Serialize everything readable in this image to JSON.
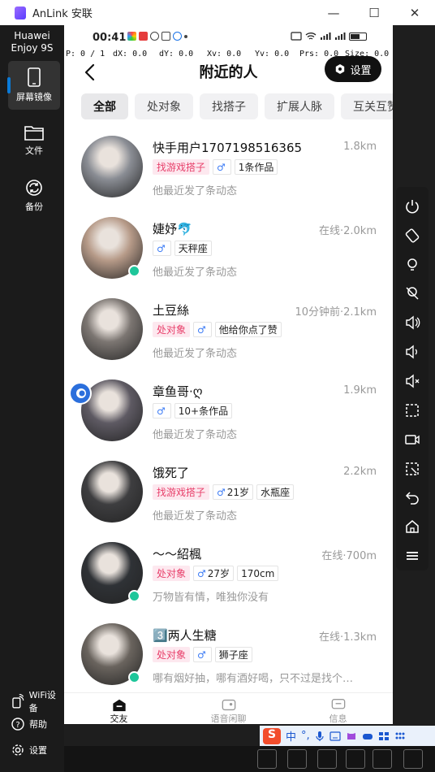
{
  "window": {
    "app_title": "AnLink 安联",
    "minimize": "—",
    "maximize": "☐",
    "close": "✕"
  },
  "sidebar": {
    "device_name_line1": "Huawei",
    "device_name_line2": "Enjoy 9S",
    "items": [
      {
        "label": "屏幕镜像",
        "icon": "phone-icon",
        "active": true
      },
      {
        "label": "文件",
        "icon": "folder-icon"
      },
      {
        "label": "备份",
        "icon": "sync-icon"
      }
    ],
    "bottom": [
      {
        "label": "WiFi设备",
        "icon": "wifi-phone-icon"
      },
      {
        "label": "帮助",
        "icon": "help-icon"
      },
      {
        "label": "设置",
        "icon": "gear-icon"
      }
    ]
  },
  "phone": {
    "status": {
      "time": "00:41",
      "battery_level": 0.6
    },
    "debug": {
      "p": "P: 0 / 1",
      "dx": "dX: 0.0",
      "dy": "dY: 0.0",
      "xv": "Xv: 0.0",
      "yv": "Yv: 0.0",
      "prs": "Prs: 0.0",
      "size": "Size: 0.0"
    },
    "header": {
      "title": "附近的人",
      "settings_label": "设置"
    },
    "tabs": [
      "全部",
      "处对象",
      "找搭子",
      "扩展人脉",
      "互关互赞"
    ],
    "people": [
      {
        "name": "快手用户1707198516365",
        "distance": "1.8km",
        "online": false,
        "tags": [
          {
            "text": "找游戏搭子",
            "style": "pink"
          },
          {
            "text": "",
            "style": "male"
          },
          {
            "text": "1条作品",
            "style": "plain"
          }
        ],
        "sub": "他最近发了条动态",
        "avatar_color": "#8a8d94"
      },
      {
        "name": "婕妤🐬",
        "distance": "在线·2.0km",
        "online": true,
        "tags": [
          {
            "text": "",
            "style": "male"
          },
          {
            "text": "天秤座",
            "style": "plain"
          }
        ],
        "sub": "他最近发了条动态",
        "avatar_color": "#b69a88"
      },
      {
        "name": "土豆絲",
        "distance": "10分钟前·2.1km",
        "online": false,
        "tags": [
          {
            "text": "处对象",
            "style": "pink"
          },
          {
            "text": "",
            "style": "male"
          },
          {
            "text": "他给你点了赞",
            "style": "plain"
          }
        ],
        "sub": "他最近发了条动态",
        "avatar_color": "#7c7672"
      },
      {
        "name": "章鱼哥·ღ",
        "distance": "1.9km",
        "online": false,
        "tags": [
          {
            "text": "",
            "style": "male"
          },
          {
            "text": "10+条作品",
            "style": "plain"
          }
        ],
        "sub": "他最近发了条动态",
        "avatar_color": "#5e5a63"
      },
      {
        "name": "饿死了",
        "distance": "2.2km",
        "online": false,
        "tags": [
          {
            "text": "找游戏搭子",
            "style": "pink"
          },
          {
            "text": "21岁",
            "style": "male"
          },
          {
            "text": "水瓶座",
            "style": "plain"
          }
        ],
        "sub": "他最近发了条动态",
        "avatar_color": "#3e3e40"
      },
      {
        "name": "～～紹楓",
        "distance": "在线·700m",
        "online": true,
        "tags": [
          {
            "text": "处对象",
            "style": "pink"
          },
          {
            "text": "27岁",
            "style": "male"
          },
          {
            "text": "170cm",
            "style": "plain"
          }
        ],
        "sub": "万物皆有情，唯独你没有",
        "avatar_color": "#2f3236"
      },
      {
        "name": "3️⃣两人生糖",
        "distance": "在线·1.3km",
        "online": true,
        "tags": [
          {
            "text": "处对象",
            "style": "pink"
          },
          {
            "text": "",
            "style": "male"
          },
          {
            "text": "狮子座",
            "style": "plain"
          }
        ],
        "sub": "哪有烟好抽，哪有酒好喝，只不过是找个…",
        "avatar_color": "#6a645e"
      }
    ],
    "bottom_nav": [
      {
        "label": "交友",
        "active": true
      },
      {
        "label": "语音闲聊",
        "active": false
      },
      {
        "label": "信息",
        "active": false
      }
    ]
  },
  "ime": {
    "logo": "S",
    "lang": "中",
    "punct": "°,"
  }
}
